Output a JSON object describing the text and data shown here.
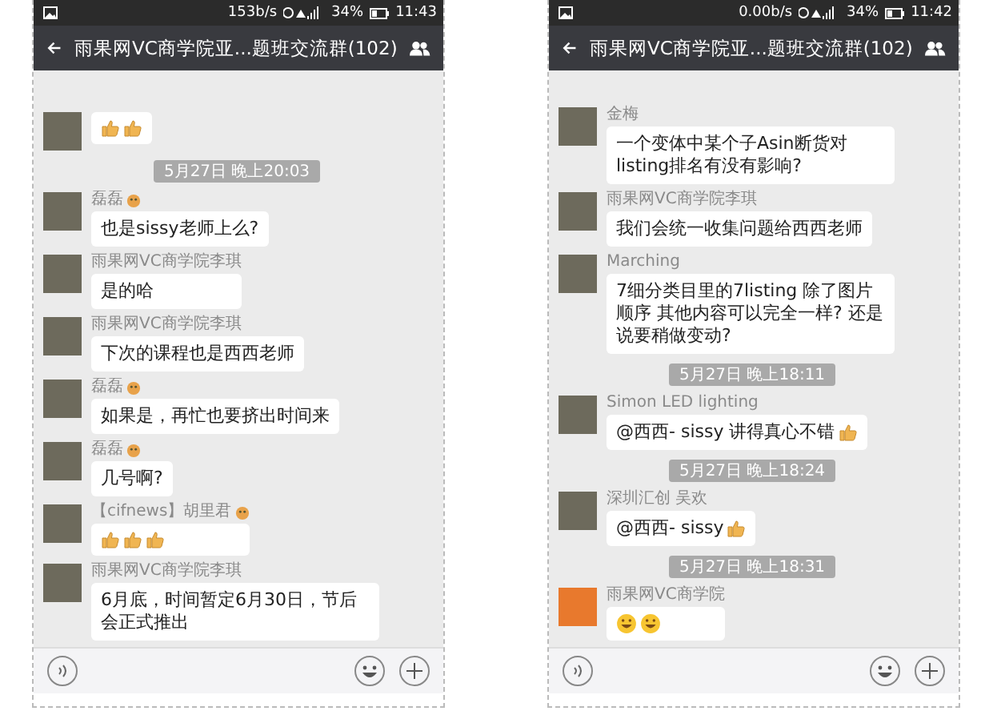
{
  "phones": [
    {
      "status": {
        "speed": "153b/s",
        "battery": "34%",
        "time": "11:43"
      },
      "title": "雨果网VC商学院亚...题班交流群(102)",
      "items": [
        {
          "kind": "message",
          "emojis": [
            {
              "kind": "thumbs"
            },
            {
              "kind": "thumbs"
            }
          ]
        },
        {
          "kind": "time",
          "text": "5月27日 晚上20:03"
        },
        {
          "kind": "message",
          "sender": "磊磊",
          "badge": true,
          "text": "也是sissy老师上么?"
        },
        {
          "kind": "message",
          "sender": "雨果网VC商学院李琪",
          "text": "是的哈"
        },
        {
          "kind": "message",
          "sender": "雨果网VC商学院李琪",
          "text": "下次的课程也是西西老师"
        },
        {
          "kind": "message",
          "sender": "磊磊",
          "badge": true,
          "text": "如果是，再忙也要挤出时间来"
        },
        {
          "kind": "message",
          "sender": "磊磊",
          "badge": true,
          "text": "几号啊?"
        },
        {
          "kind": "message",
          "sender": "【cifnews】胡里君",
          "badge": true,
          "emojis": [
            {
              "kind": "thumbs"
            },
            {
              "kind": "thumbs"
            },
            {
              "kind": "thumbs"
            }
          ]
        },
        {
          "kind": "message",
          "sender": "雨果网VC商学院李琪",
          "text": "6月底，时间暂定6月30日，节后会正式推出"
        }
      ]
    },
    {
      "status": {
        "speed": "0.00b/s",
        "battery": "34%",
        "time": "11:42"
      },
      "title": "雨果网VC商学院亚...题班交流群(102)",
      "items": [
        {
          "kind": "message",
          "sender": "金梅",
          "text": "一个变体中某个子Asin断货对listing排名有没有影响?"
        },
        {
          "kind": "message",
          "sender": "雨果网VC商学院李琪",
          "text": "我们会统一收集问题给西西老师"
        },
        {
          "kind": "message",
          "sender": "Marching",
          "text": "7细分类目里的7listing 除了图片顺序 其他内容可以完全一样? 还是说要稍做变动?"
        },
        {
          "kind": "time",
          "text": "5月27日 晚上18:11"
        },
        {
          "kind": "message",
          "sender": "Simon LED lighting",
          "text": "@西西- sissy 讲得真心不错",
          "emojis": [
            {
              "kind": "thumbs"
            }
          ]
        },
        {
          "kind": "time",
          "text": "5月27日 晚上18:24"
        },
        {
          "kind": "message",
          "sender": "深圳汇创 吴欢",
          "text": "@西西- sissy",
          "emojis": [
            {
              "kind": "thumbs"
            }
          ]
        },
        {
          "kind": "time",
          "text": "5月27日 晚上18:31"
        },
        {
          "kind": "message",
          "sender": "雨果网VC商学院",
          "color": "#e8792d",
          "emojis": [
            {
              "kind": "grin"
            },
            {
              "kind": "grin"
            }
          ]
        }
      ]
    }
  ]
}
